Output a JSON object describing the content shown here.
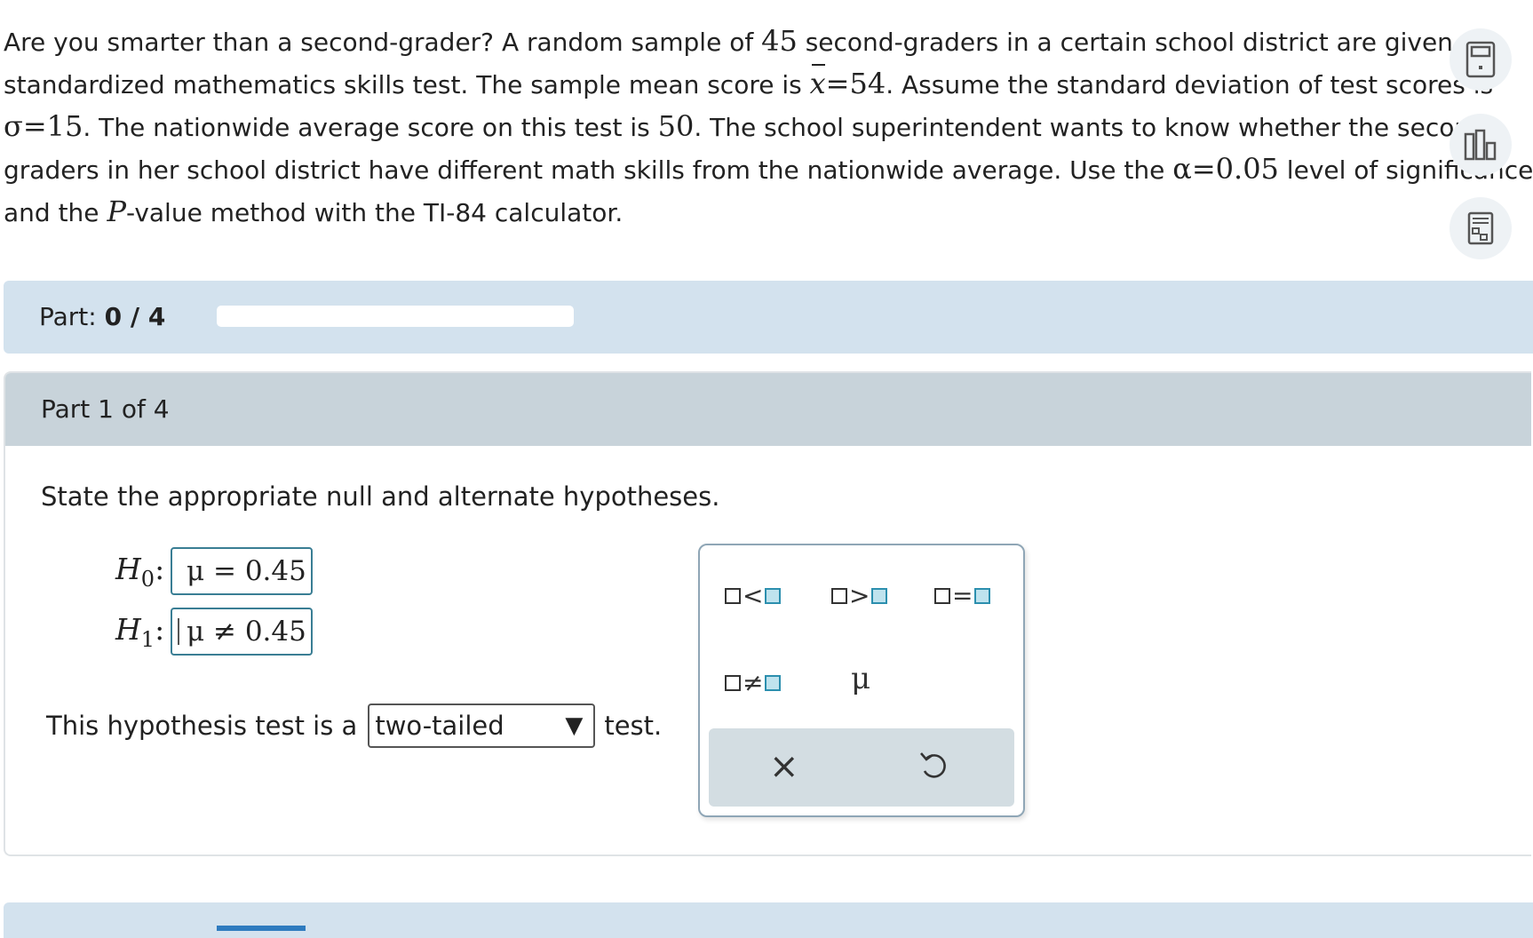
{
  "problem": {
    "line1_a": "Are you smarter than a second-grader? A random sample of ",
    "sample_size": "45",
    "line1_b": " second-graders in a certain school district are given a",
    "line2_a": "standardized mathematics skills test. The sample mean score is ",
    "xbar_symbol": "x",
    "equals": "=",
    "sample_mean": "54",
    "line2_b": ". Assume the standard deviation of test scores is",
    "sigma_symbol": "σ",
    "sigma_value": "15",
    "line3_a": ". The nationwide average score on this test is ",
    "population_mean": "50",
    "line3_b": ". The school superintendent wants to know whether the second-",
    "line4_a": "graders in her school district have different math skills from the nationwide average. Use the ",
    "alpha_symbol": "α",
    "alpha_value": "0.05",
    "line4_b": " level of significance",
    "line5_a": "and the ",
    "p_symbol": "P",
    "line5_b": "-value method with the TI-84 calculator."
  },
  "tools": {
    "icon1": "calculator-icon",
    "icon2": "chart-icon",
    "icon3": "data-table-icon"
  },
  "progress": {
    "label": "Part:",
    "value": "0 / 4",
    "fraction": 0
  },
  "part": {
    "title": "Part 1 of 4",
    "instruction": "State the appropriate null and alternate hypotheses.",
    "h0_label": "H",
    "h0_sub": "0",
    "h0_value": "μ = 0.45",
    "h1_label": "H",
    "h1_sub": "1",
    "h1_value": "μ ≠ 0.45",
    "colon": ":",
    "tail_prefix": "This hypothesis test is a",
    "tail_value": "two-tailed",
    "tail_arrow": "▼",
    "tail_suffix": "test."
  },
  "palette": {
    "lt": "<",
    "gt": ">",
    "eq": "=",
    "neq": "≠",
    "mu": "μ",
    "clear": "×",
    "undo_icon": "undo-icon"
  },
  "colors": {
    "accent": "#2e7bbf",
    "part_bar": "#d3e2ee",
    "header": "#c8d3da",
    "input_border": "#3a7e94"
  }
}
